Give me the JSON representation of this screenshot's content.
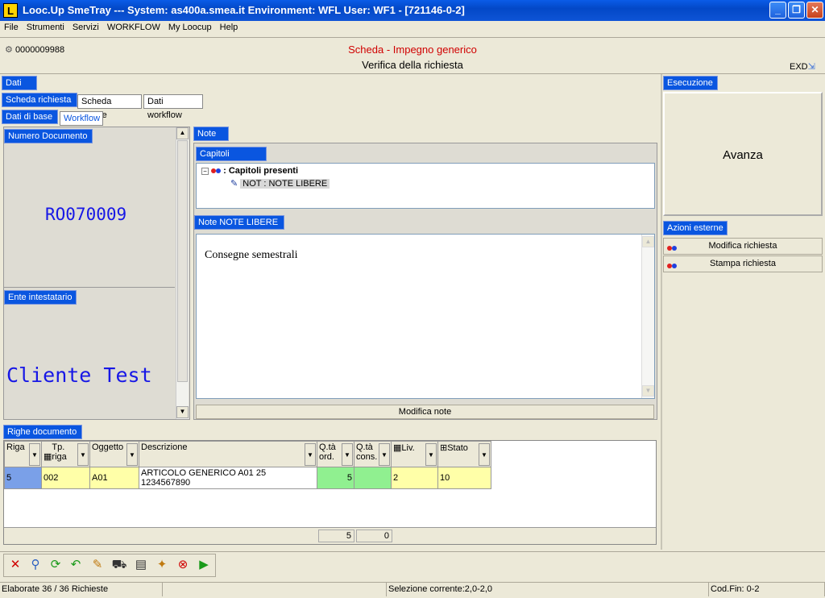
{
  "window": {
    "title": "Looc.Up SmeTray --- System: as400a.smea.it Environment: WFL User: WF1 - [721146-0-2]",
    "logo": "L"
  },
  "menu": [
    "File",
    "Strumenti",
    "Servizi",
    "WORKFLOW",
    "My Loocup",
    "Help"
  ],
  "header": {
    "doc_number": "0000009988",
    "heading1": "Scheda - Impegno generico",
    "heading2": "Verifica della richiesta",
    "exd": "EXD"
  },
  "tabs": {
    "dati": "Dati",
    "level1": [
      "Scheda richiesta",
      "Scheda cliente",
      "Dati workflow"
    ],
    "level2": [
      "Dati di base",
      "Workflow"
    ]
  },
  "left": {
    "numero_label": "Numero Documento",
    "numero_value": "RO070009",
    "ente_label": "Ente intestatario",
    "ente_value": "Cliente Test"
  },
  "notes": {
    "note_tab": "Note",
    "capitoli_tab": "Capitoli presenti",
    "tree_root": ": Capitoli presenti",
    "tree_child": "NOT  : NOTE LIBERE",
    "note_libere_tab": "Note NOTE LIBERE",
    "text": "Consegne semestrali",
    "modifica_button": "Modifica note"
  },
  "right": {
    "esecuzione_tab": "Esecuzione",
    "avanza": "Avanza",
    "azioni_tab": "Azioni esterne",
    "azioni": [
      "Modifica richiesta",
      "Stampa richiesta"
    ]
  },
  "righe": {
    "tab": "Righe documento",
    "columns": [
      "Riga",
      "Tp. riga",
      "Oggetto",
      "Descrizione",
      "Q.tà ord.",
      "Q.tà cons.",
      "Liv.",
      "Stato"
    ],
    "rows": [
      [
        "5",
        "002",
        "A01",
        "ARTICOLO GENERICO A01 25 1234567890",
        "5",
        "",
        "2",
        "10"
      ]
    ],
    "totals": [
      "5",
      "0"
    ]
  },
  "status": {
    "left": "Elaborate 36 / 36 Richieste",
    "middle": "Selezione corrente:2,0-2,0",
    "right": "Cod.Fin: 0-2"
  },
  "colors": {
    "tab_blue": "#0a56e0",
    "heading_red": "#d00000",
    "value_blue": "#1717e6",
    "row_yellow": "#ffffa8",
    "row_green": "#90f090",
    "row_selected": "#7aa0e8"
  }
}
